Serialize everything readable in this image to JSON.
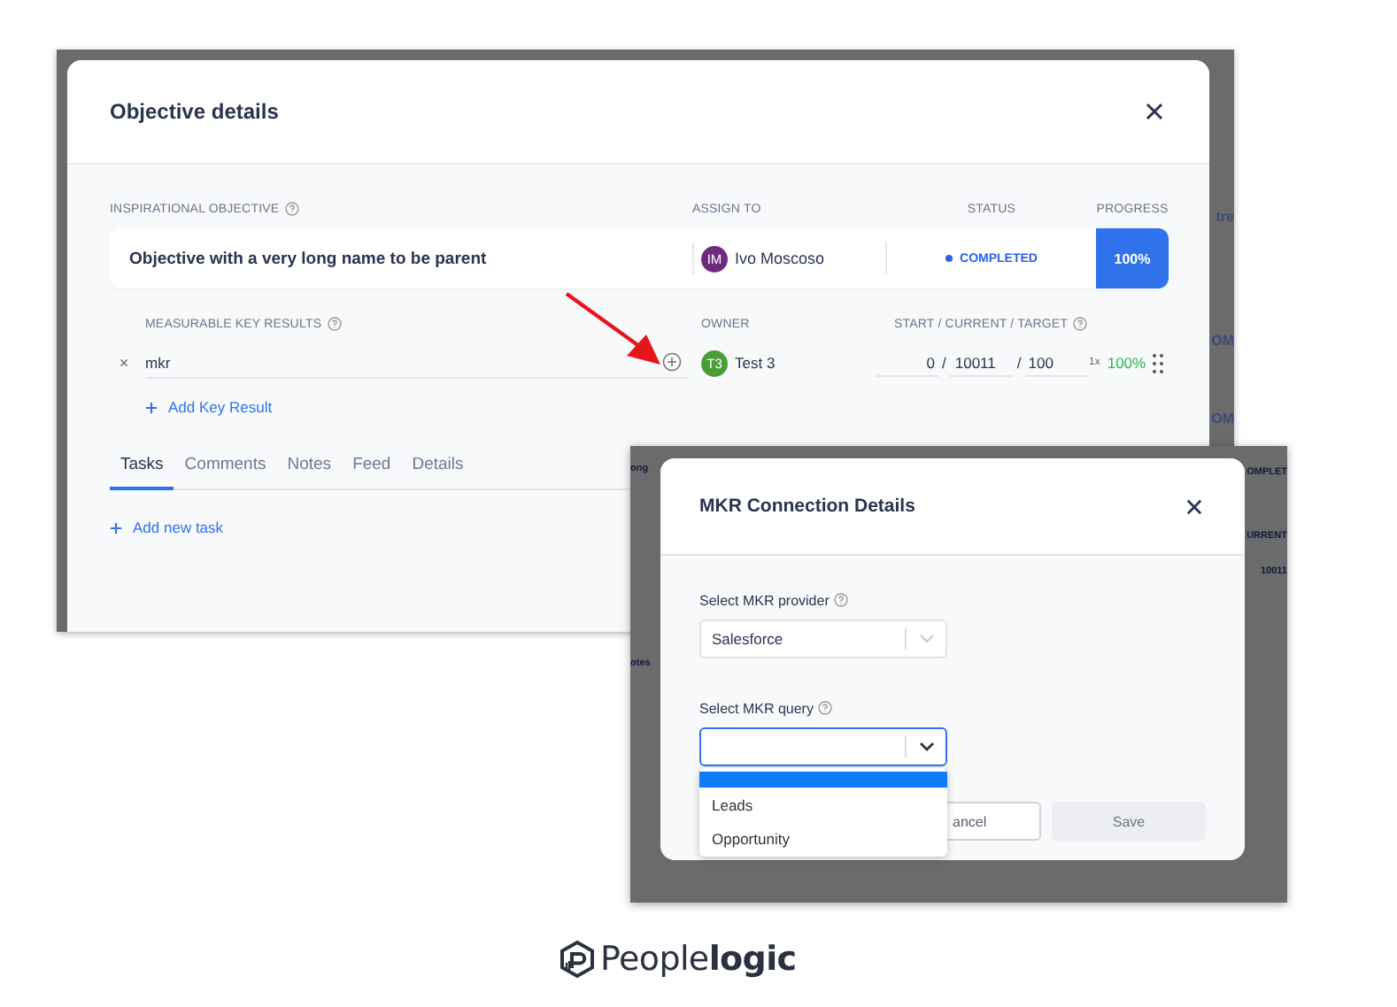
{
  "objective_dialog": {
    "title": "Objective details",
    "columns": {
      "objective": "INSPIRATIONAL OBJECTIVE",
      "assign_to": "ASSIGN TO",
      "status": "STATUS",
      "progress": "PROGRESS"
    },
    "objective": {
      "name": "Objective with a very long name to be parent",
      "assignee": {
        "initials": "IM",
        "name": "Ivo Moscoso"
      },
      "status": "COMPLETED",
      "progress": "100%"
    },
    "key_result_columns": {
      "name": "MEASURABLE KEY RESULTS",
      "owner": "OWNER",
      "values": "START / CURRENT / TARGET"
    },
    "key_results": [
      {
        "remove": "×",
        "name": "mkr",
        "owner": {
          "initials": "T3",
          "name": "Test 3"
        },
        "start": "0",
        "separator": "/",
        "current": "10011",
        "target": "100",
        "multiplier": "1x",
        "progress": "100%"
      }
    ],
    "add_key_result": "Add Key Result",
    "tabs": [
      {
        "label": "Tasks",
        "selected": true
      },
      {
        "label": "Comments",
        "selected": false
      },
      {
        "label": "Notes",
        "selected": false
      },
      {
        "label": "Feed",
        "selected": false
      },
      {
        "label": "Details",
        "selected": false
      }
    ],
    "add_task": "Add new task",
    "edge_fragments": [
      "tre",
      "OM",
      "OM"
    ]
  },
  "mkr_dialog": {
    "title": "MKR Connection Details",
    "provider": {
      "label": "Select MKR provider",
      "value": "Salesforce"
    },
    "query": {
      "label": "Select MKR query",
      "focused": true
    },
    "dropdown": {
      "blank_option_selected": true,
      "options": [
        {
          "label": "Leads",
          "selected": false
        },
        {
          "label": "Opportunity",
          "selected": false
        }
      ]
    },
    "buttons": {
      "cancel": "ancel",
      "save": "Save"
    },
    "background_fragments": [
      "ong",
      "otes",
      "OMPLET",
      "URRENT",
      "10011"
    ]
  },
  "logo": {
    "text": "People**logic**"
  }
}
